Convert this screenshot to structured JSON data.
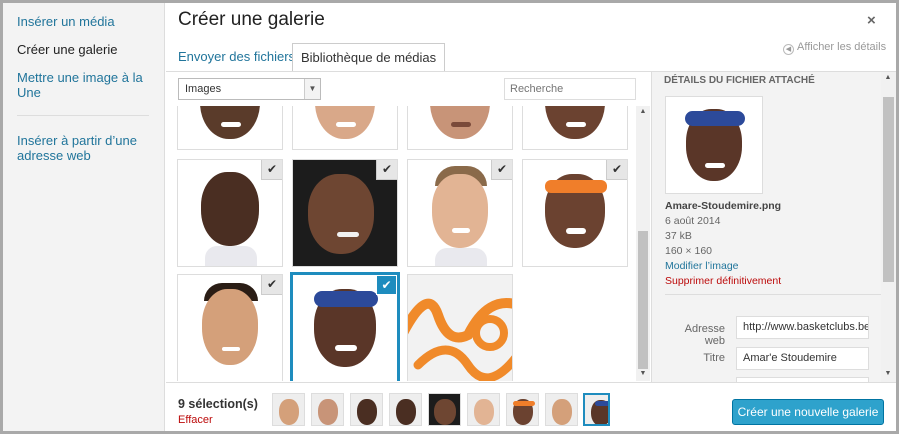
{
  "sidebar": {
    "items": [
      {
        "label": "Insérer un média"
      },
      {
        "label": "Créer une galerie"
      },
      {
        "label": "Mettre une image à la Une"
      },
      {
        "label": "Insérer à partir d’une adresse web"
      }
    ]
  },
  "header": {
    "title": "Créer une galerie",
    "close_icon": "×",
    "tabs": [
      {
        "label": "Envoyer des fichiers"
      },
      {
        "label": "Bibliothèque de médias"
      }
    ],
    "toggle_details": "Afficher les détails"
  },
  "toolbar": {
    "filter_value": "Images",
    "search_placeholder": "Recherche"
  },
  "grid": {
    "check_icon": "✔"
  },
  "details": {
    "heading": "DÉTAILS DU FICHIER ATTACHÉ",
    "filename": "Amare-Stoudemire.png",
    "date": "6 août 2014",
    "size": "37 kB",
    "dimensions": "160 × 160",
    "edit_link": "Modifier l’image",
    "delete_link": "Supprimer définitivement",
    "url_label": "Adresse web",
    "url_value": "http://www.basketclubs.be",
    "title_label": "Titre",
    "title_value": "Amar'e Stoudemire"
  },
  "bottom": {
    "selection_count": "9 sélection(s)",
    "clear_label": "Effacer",
    "create_button": "Créer une nouvelle galerie"
  },
  "colors": {
    "accent": "#1e8cbe",
    "button": "#2ea2cc",
    "link": "#21759b",
    "danger": "#bc0b0b"
  }
}
